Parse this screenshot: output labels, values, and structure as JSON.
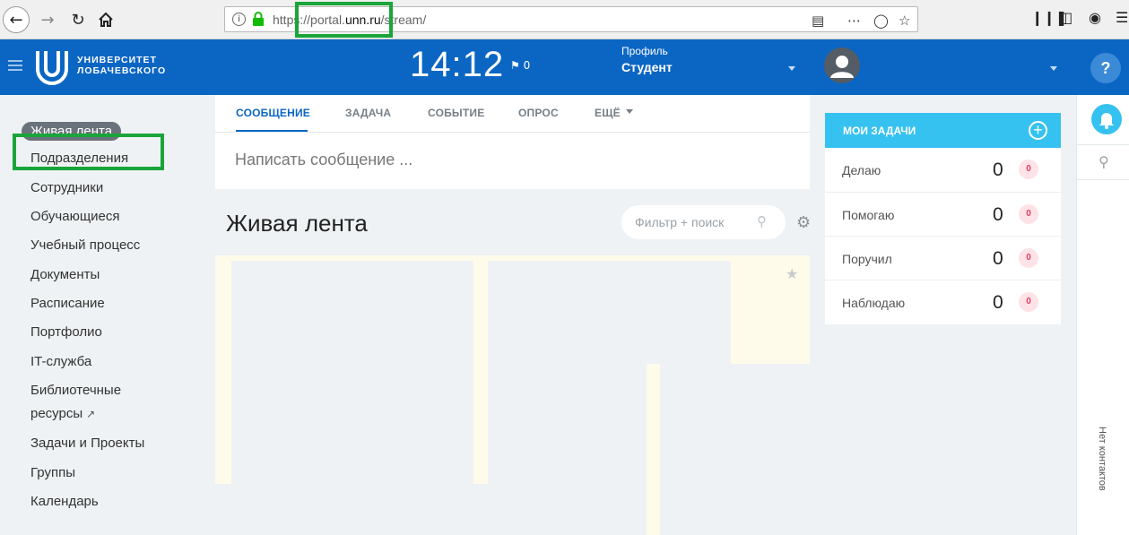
{
  "browser": {
    "url_scheme": "https:",
    "url_slashes": "//portal.",
    "url_host": "unn.ru",
    "url_path": "/stream/"
  },
  "header": {
    "logo_line1": "УНИВЕРСИТЕТ",
    "logo_line2": "ЛОБАЧЕВСКОГО",
    "clock": "14:12",
    "flag_count": "0",
    "profile_label": "Профиль",
    "profile_value": "Студент",
    "help_label": "?"
  },
  "menu": {
    "items": [
      {
        "label": "Живая лента"
      },
      {
        "label": "Подразделения"
      },
      {
        "label": "Сотрудники"
      },
      {
        "label": "Обучающиеся"
      },
      {
        "label": "Учебный процесс"
      },
      {
        "label": "Документы"
      },
      {
        "label": "Расписание"
      },
      {
        "label": "Портфолио"
      },
      {
        "label": "IT-служба"
      },
      {
        "label": "Библиотечные"
      },
      {
        "label": "ресурсы"
      },
      {
        "label": "Задачи и Проекты"
      },
      {
        "label": "Группы"
      },
      {
        "label": "Календарь"
      }
    ]
  },
  "composer": {
    "tabs": [
      {
        "label": "СООБЩЕНИЕ"
      },
      {
        "label": "ЗАДАЧА"
      },
      {
        "label": "СОБЫТИЕ"
      },
      {
        "label": "ОПРОС"
      },
      {
        "label": "ЕЩЁ"
      }
    ],
    "placeholder": "Написать сообщение ..."
  },
  "feed": {
    "title": "Живая лента",
    "filter_placeholder": "Фильтр + поиск"
  },
  "tasks": {
    "title": "МОИ ЗАДАЧИ",
    "add_label": "+",
    "rows": [
      {
        "label": "Делаю",
        "count": "0",
        "badge": "0"
      },
      {
        "label": "Помогаю",
        "count": "0",
        "badge": "0"
      },
      {
        "label": "Поручил",
        "count": "0",
        "badge": "0"
      },
      {
        "label": "Наблюдаю",
        "count": "0",
        "badge": "0"
      }
    ]
  },
  "rightbar": {
    "no_contacts": "Нет контактов"
  },
  "colors": {
    "brand_blue": "#0b66c3",
    "accent_cyan": "#36c2f0",
    "highlight_green": "#1aa53a"
  }
}
